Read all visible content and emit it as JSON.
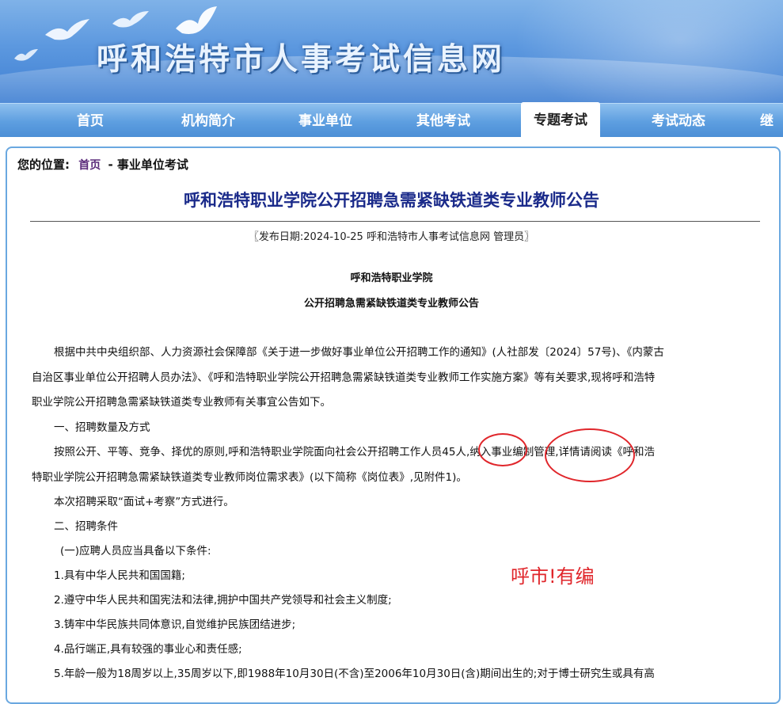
{
  "site": {
    "title": "呼和浩特市人事考试信息网"
  },
  "nav": {
    "items": [
      {
        "label": "首页"
      },
      {
        "label": "机构简介"
      },
      {
        "label": "事业单位"
      },
      {
        "label": "其他考试"
      },
      {
        "label": "专题考试"
      },
      {
        "label": "考试动态"
      },
      {
        "label": "继"
      }
    ],
    "active_label": "专题考试"
  },
  "breadcrumb": {
    "prefix": "您的位置:",
    "home": "首页",
    "current": "- 事业单位考试"
  },
  "article": {
    "title": "呼和浩特职业学院公开招聘急需紧缺铁道类专业教师公告",
    "meta": "〖发布日期:2024-10-25 呼和浩特市人事考试信息网 管理员〗",
    "org": "呼和浩特职业学院",
    "subtitle": "公开招聘急需紧缺铁道类专业教师公告",
    "lines": [
      "根据中共中央组织部、人力资源社会保障部《关于进一步做好事业单位公开招聘工作的通知》(人社部发〔2024〕57号)、《内蒙古",
      "自治区事业单位公开招聘人员办法》、《呼和浩特职业学院公开招聘急需紧缺铁道类专业教师工作实施方案》等有关要求,现将呼和浩特",
      "职业学院公开招聘急需紧缺铁道类专业教师有关事宜公告如下。",
      "一、招聘数量及方式",
      "按照公开、平等、竞争、择优的原则,呼和浩特职业学院面向社会公开招聘工作人员45人,纳入事业编制管理,详情请阅读《呼和浩",
      "特职业学院公开招聘急需紧缺铁道类专业教师岗位需求表》(以下简称《岗位表》,见附件1)。",
      "本次招聘采取“面试+考察”方式进行。",
      "二、招聘条件",
      "(一)应聘人员应当具备以下条件:",
      "1.具有中华人民共和国国籍;",
      "2.遵守中华人民共和国宪法和法律,拥护中国共产党领导和社会主义制度;",
      "3.铸牢中华民族共同体意识,自觉维护民族团结进步;",
      "4.品行端正,具有较强的事业心和责任感;",
      "5.年龄一般为18周岁以上,35周岁以下,即1988年10月30日(不含)至2006年10月30日(含)期间出生的;对于博士研究生或具有高"
    ]
  },
  "annotation": {
    "text": "呼市!有编",
    "color": "#e0262b"
  },
  "colors": {
    "nav_blue": "#5d9ee0",
    "title_navy": "#1a2a8a",
    "annotation_red": "#e0262b"
  }
}
